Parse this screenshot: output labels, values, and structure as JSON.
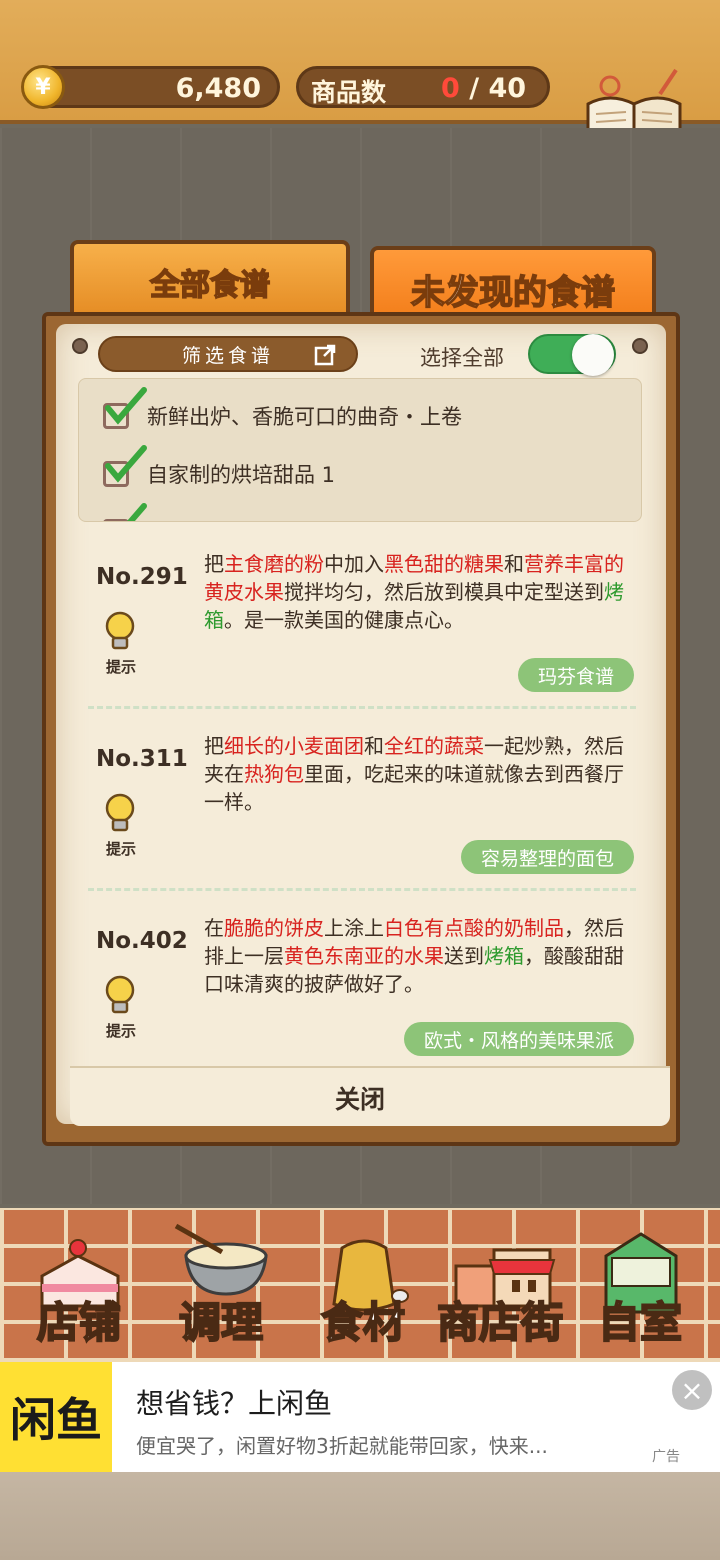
{
  "topbar": {
    "coin_symbol": "¥",
    "money": "6,480",
    "goods_label": "商品数",
    "goods_current": "0",
    "goods_total": "/ 40",
    "recipe_book_label": "食谱"
  },
  "tabs": {
    "all": "全部食谱",
    "undiscovered": "未发现的食谱"
  },
  "filter": {
    "button_label": "筛选食谱",
    "select_all_label": "选择全部",
    "select_all_on": true,
    "items": [
      "新鲜出炉、香脆可口的曲奇・上卷",
      "自家制的烘培甜品 1"
    ]
  },
  "recipes": [
    {
      "no": "No.291",
      "hint": "提示",
      "desc": [
        {
          "t": "把",
          "c": ""
        },
        {
          "t": "主食磨的粉",
          "c": "r"
        },
        {
          "t": "中加入",
          "c": ""
        },
        {
          "t": "黑色甜的糖果",
          "c": "r"
        },
        {
          "t": "和",
          "c": ""
        },
        {
          "t": "营养丰富的黄皮水果",
          "c": "r"
        },
        {
          "t": "搅拌均匀，然后放到模具中定型送到",
          "c": ""
        },
        {
          "t": "烤箱",
          "c": "g"
        },
        {
          "t": "。是一款美国的健康点心。",
          "c": ""
        }
      ],
      "tag": "玛芬食谱"
    },
    {
      "no": "No.311",
      "hint": "提示",
      "desc": [
        {
          "t": "把",
          "c": ""
        },
        {
          "t": "细长的小麦面团",
          "c": "r"
        },
        {
          "t": "和",
          "c": ""
        },
        {
          "t": "全红的蔬菜",
          "c": "r"
        },
        {
          "t": "一起炒熟，然后夹在",
          "c": ""
        },
        {
          "t": "热狗包",
          "c": "r"
        },
        {
          "t": "里面，吃起来的味道就像去到西餐厅一样。",
          "c": ""
        }
      ],
      "tag": "容易整理的面包"
    },
    {
      "no": "No.402",
      "hint": "提示",
      "desc": [
        {
          "t": "在",
          "c": ""
        },
        {
          "t": "脆脆的饼皮",
          "c": "r"
        },
        {
          "t": "上涂上",
          "c": ""
        },
        {
          "t": "白色有点酸的奶制品",
          "c": "r"
        },
        {
          "t": "，然后排上一层",
          "c": ""
        },
        {
          "t": "黄色东南亚的水果",
          "c": "r"
        },
        {
          "t": "送到",
          "c": ""
        },
        {
          "t": "烤箱",
          "c": "g"
        },
        {
          "t": "，酸酸甜甜口味清爽的披萨做好了。",
          "c": ""
        }
      ],
      "tag": "欧式・风格的美味果派"
    }
  ],
  "close_label": "关闭",
  "nav": [
    {
      "label": "店铺",
      "icon": "cake-icon"
    },
    {
      "label": "调理",
      "icon": "mixing-bowl-icon"
    },
    {
      "label": "食材",
      "icon": "flour-sack-icon"
    },
    {
      "label": "商店街",
      "icon": "shop-icon"
    },
    {
      "label": "自室",
      "icon": "staff-only-door-icon"
    }
  ],
  "ad": {
    "logo_text": "闲鱼",
    "title": "想省钱？上闲鱼",
    "subtitle": "便宜哭了，闲置好物3折起就能带回家，快来...",
    "tag": "广告",
    "close": "×"
  },
  "colors": {
    "highlight_red": "#d8231f",
    "highlight_green": "#2e9a2e",
    "tag_green": "#8dc478",
    "toggle_green": "#3fae57",
    "tab_orange": "#f17a16"
  }
}
